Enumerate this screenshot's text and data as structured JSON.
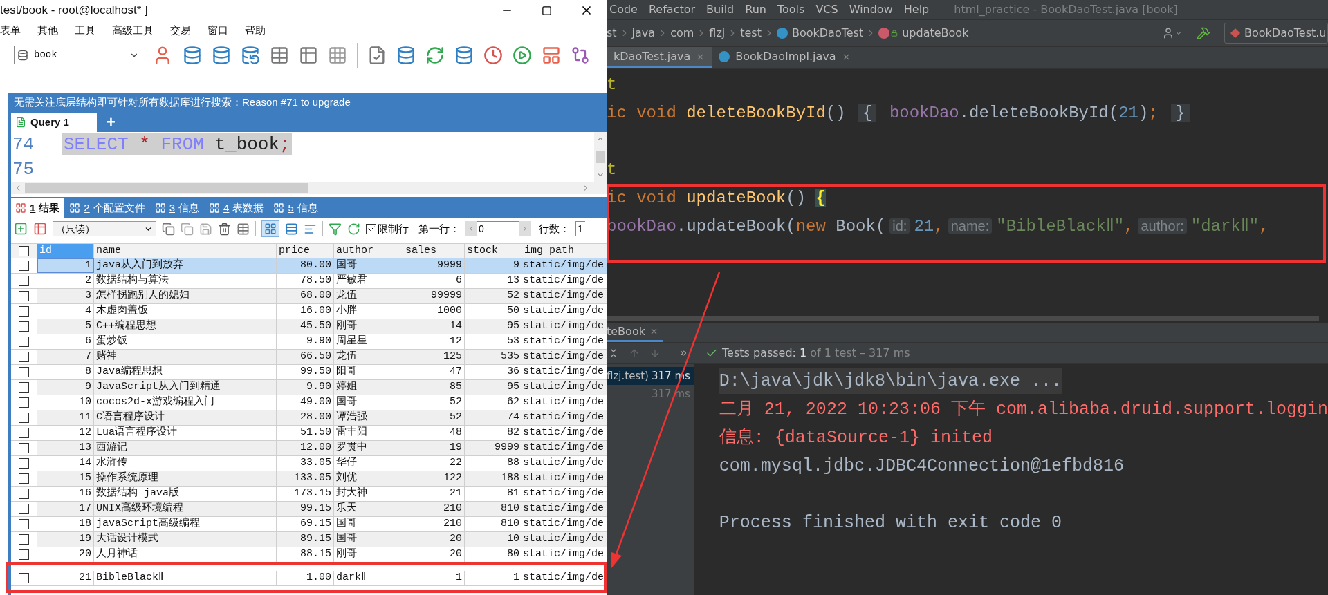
{
  "db_window": {
    "title": "test/book - root@localhost* ]",
    "menu": [
      "表单",
      "其他",
      "工具",
      "高级工具",
      "交易",
      "窗口",
      "帮助"
    ],
    "database_select": "book",
    "banner": "无需关注底层结构即可针对所有数据库进行搜索：Reason #71 to upgrade",
    "query_tabs": [
      {
        "label": "Query 1",
        "selected": true
      }
    ],
    "add_tab": "+",
    "editor_lines": [
      {
        "number": "74",
        "selected": true,
        "tokens": [
          {
            "kind": "keyword",
            "text": "SELECT"
          },
          {
            "kind": "operator",
            "text": " * "
          },
          {
            "kind": "keyword",
            "text": "FROM"
          },
          {
            "kind": "plain",
            "text": " t_book"
          },
          {
            "kind": "operator",
            "text": ";"
          }
        ]
      },
      {
        "number": "75"
      }
    ],
    "result_tabs": [
      {
        "number": "1",
        "label": "结果",
        "selected": true
      },
      {
        "number": "2",
        "label": "个配置文件",
        "selected": false
      },
      {
        "number": "3",
        "label": "信息",
        "selected": false
      },
      {
        "number": "4",
        "label": "表数据",
        "selected": false
      },
      {
        "number": "5",
        "label": "信息",
        "selected": false
      }
    ],
    "result_toolbar": {
      "mode_select": "（只读）",
      "limit_rows": {
        "label": "限制行",
        "checked": true
      },
      "first_row": {
        "label": "第一行：",
        "value": "0"
      },
      "row_count": {
        "label": "行数：",
        "value": "1"
      }
    },
    "table": {
      "select_all_checked": false,
      "columns": [
        {
          "label": "id",
          "kind": "number",
          "selected": true
        },
        {
          "label": "name",
          "kind": "text",
          "selected": false
        },
        {
          "label": "price",
          "kind": "number",
          "selected": false
        },
        {
          "label": "author",
          "kind": "text",
          "selected": false
        },
        {
          "label": "sales",
          "kind": "number",
          "selected": false
        },
        {
          "label": "stock",
          "kind": "number",
          "selected": false
        },
        {
          "label": "img_path",
          "kind": "text",
          "selected": false
        }
      ],
      "rows": [
        {
          "checked": false,
          "selected": true,
          "cells": [
            "1",
            "java从入门到放弃",
            "80.00",
            "国哥",
            "9999",
            "9",
            "static/img/de"
          ]
        },
        {
          "checked": false,
          "selected": false,
          "cells": [
            "2",
            "数据结构与算法",
            "78.50",
            "严敏君",
            "6",
            "13",
            "static/img/de"
          ]
        },
        {
          "checked": false,
          "selected": false,
          "cells": [
            "3",
            "怎样拐跑别人的媳妇",
            "68.00",
            "龙伍",
            "99999",
            "52",
            "static/img/de"
          ]
        },
        {
          "checked": false,
          "selected": false,
          "cells": [
            "4",
            "木虚肉盖饭",
            "16.00",
            "小胖",
            "1000",
            "50",
            "static/img/de"
          ]
        },
        {
          "checked": false,
          "selected": false,
          "cells": [
            "5",
            "C++编程思想",
            "45.50",
            "刚哥",
            "14",
            "95",
            "static/img/de"
          ]
        },
        {
          "checked": false,
          "selected": false,
          "cells": [
            "6",
            "蛋炒饭",
            "9.90",
            "周星星",
            "12",
            "53",
            "static/img/de"
          ]
        },
        {
          "checked": false,
          "selected": false,
          "cells": [
            "7",
            "赌神",
            "66.50",
            "龙伍",
            "125",
            "535",
            "static/img/de"
          ]
        },
        {
          "checked": false,
          "selected": false,
          "cells": [
            "8",
            "Java编程思想",
            "99.50",
            "阳哥",
            "47",
            "36",
            "static/img/de"
          ]
        },
        {
          "checked": false,
          "selected": false,
          "cells": [
            "9",
            "JavaScript从入门到精通",
            "9.90",
            "婷姐",
            "85",
            "95",
            "static/img/de"
          ]
        },
        {
          "checked": false,
          "selected": false,
          "cells": [
            "10",
            "cocos2d-x游戏编程入门",
            "49.00",
            "国哥",
            "52",
            "62",
            "static/img/de"
          ]
        },
        {
          "checked": false,
          "selected": false,
          "cells": [
            "11",
            "C语言程序设计",
            "28.00",
            "谭浩强",
            "52",
            "74",
            "static/img/de"
          ]
        },
        {
          "checked": false,
          "selected": false,
          "cells": [
            "12",
            "Lua语言程序设计",
            "51.50",
            "雷丰阳",
            "48",
            "82",
            "static/img/de"
          ]
        },
        {
          "checked": false,
          "selected": false,
          "cells": [
            "13",
            "西游记",
            "12.00",
            "罗贯中",
            "19",
            "9999",
            "static/img/de"
          ]
        },
        {
          "checked": false,
          "selected": false,
          "cells": [
            "14",
            "水浒传",
            "33.05",
            "华仔",
            "22",
            "88",
            "static/img/de"
          ]
        },
        {
          "checked": false,
          "selected": false,
          "cells": [
            "15",
            "操作系统原理",
            "133.05",
            "刘优",
            "122",
            "188",
            "static/img/de"
          ]
        },
        {
          "checked": false,
          "selected": false,
          "cells": [
            "16",
            "数据结构 java版",
            "173.15",
            "封大神",
            "21",
            "81",
            "static/img/de"
          ]
        },
        {
          "checked": false,
          "selected": false,
          "cells": [
            "17",
            "UNIX高级环境编程",
            "99.15",
            "乐天",
            "210",
            "810",
            "static/img/de"
          ]
        },
        {
          "checked": false,
          "selected": false,
          "cells": [
            "18",
            "javaScript高级编程",
            "69.15",
            "国哥",
            "210",
            "810",
            "static/img/de"
          ]
        },
        {
          "checked": false,
          "selected": false,
          "cells": [
            "19",
            "大话设计模式",
            "89.15",
            "国哥",
            "20",
            "10",
            "static/img/de"
          ]
        },
        {
          "checked": false,
          "selected": false,
          "cells": [
            "20",
            "人月神话",
            "88.15",
            "刚哥",
            "20",
            "80",
            "static/img/de"
          ]
        }
      ],
      "last_row": {
        "checked": false,
        "selected": false,
        "cells": [
          "21",
          "BibleBlackⅡ",
          "1.00",
          "darkⅡ",
          "1",
          "1",
          "static/img/de"
        ]
      }
    }
  },
  "ide": {
    "menu": [
      "Code",
      "Refactor",
      "Build",
      "Run",
      "Tools",
      "VCS",
      "Window",
      "Help"
    ],
    "title": "html_practice - BookDaoTest.java [book]",
    "breadcrumbs": [
      {
        "label": "st",
        "kind": "folder"
      },
      {
        "label": "java",
        "kind": "folder"
      },
      {
        "label": "com",
        "kind": "folder"
      },
      {
        "label": "flzj",
        "kind": "folder"
      },
      {
        "label": "test",
        "kind": "folder"
      },
      {
        "label": "BookDaoTest",
        "kind": "class"
      },
      {
        "label": "updateBook",
        "kind": "method"
      }
    ],
    "run_config": "BookDaoTest.u",
    "tabs": [
      {
        "label": "kDaoTest.java",
        "kind": "file",
        "selected": true
      },
      {
        "label": "BookDaoImpl.java",
        "kind": "class",
        "selected": false
      }
    ],
    "code_lines": [
      {
        "kind": "code",
        "tokens": [
          {
            "kind": "annotation",
            "text": "t"
          }
        ]
      },
      {
        "kind": "code",
        "tokens": [
          {
            "kind": "keyword",
            "text": "ic void "
          },
          {
            "kind": "method",
            "text": "deleteBookById"
          },
          {
            "kind": "plain",
            "text": "() "
          },
          {
            "kind": "fold",
            "text": "{"
          },
          {
            "kind": "field",
            "text": " bookDao"
          },
          {
            "kind": "plain",
            "text": ".deleteBookById("
          },
          {
            "kind": "number",
            "text": "21"
          },
          {
            "kind": "plain",
            "text": ")"
          },
          {
            "kind": "keyword",
            "text": "; "
          },
          {
            "kind": "fold",
            "text": "}"
          }
        ]
      },
      {
        "kind": "blank"
      },
      {
        "kind": "code",
        "tokens": [
          {
            "kind": "annotation",
            "text": "t"
          }
        ]
      },
      {
        "kind": "code",
        "tokens": [
          {
            "kind": "keyword",
            "text": "ic void "
          },
          {
            "kind": "method",
            "text": "updateBook"
          },
          {
            "kind": "plain",
            "text": "() "
          },
          {
            "kind": "brace_match",
            "text": "{"
          }
        ]
      },
      {
        "kind": "code",
        "tokens": [
          {
            "kind": "field",
            "text": "bookDao"
          },
          {
            "kind": "plain",
            "text": ".updateBook("
          },
          {
            "kind": "keyword",
            "text": "new"
          },
          {
            "kind": "plain",
            "text": " Book("
          },
          {
            "kind": "hint",
            "text": "id:"
          },
          {
            "kind": "number",
            "text": "21"
          },
          {
            "kind": "keyword",
            "text": ","
          },
          {
            "kind": "hint",
            "text": "name:"
          },
          {
            "kind": "string",
            "text": "\"BibleBlackⅡ\""
          },
          {
            "kind": "keyword",
            "text": ","
          },
          {
            "kind": "hint",
            "text": "author:"
          },
          {
            "kind": "string",
            "text": "\"darkⅡ\""
          },
          {
            "kind": "keyword",
            "text": ","
          }
        ]
      }
    ],
    "run_tab": "teBook",
    "test_status": {
      "label": "Tests passed:",
      "count": "1",
      "detail": "of 1 test – 317 ms"
    },
    "test_tree": [
      {
        "label": "flzj.test)",
        "time": "317 ms",
        "selected": true
      },
      {
        "time": "317 ms",
        "selected": false
      }
    ],
    "console": [
      {
        "kind": "command",
        "text": "D:\\java\\jdk\\jdk8\\bin\\java.exe ..."
      },
      {
        "kind": "error",
        "text": "二月 21, 2022 10:23:06 下午 com.alibaba.druid.support.loggin"
      },
      {
        "kind": "error",
        "text": "信息: {dataSource-1} inited"
      },
      {
        "kind": "output",
        "text": "com.mysql.jdbc.JDBC4Connection@1efbd816"
      },
      {
        "kind": "blank"
      },
      {
        "kind": "output",
        "text": "Process finished with exit code 0"
      }
    ]
  }
}
